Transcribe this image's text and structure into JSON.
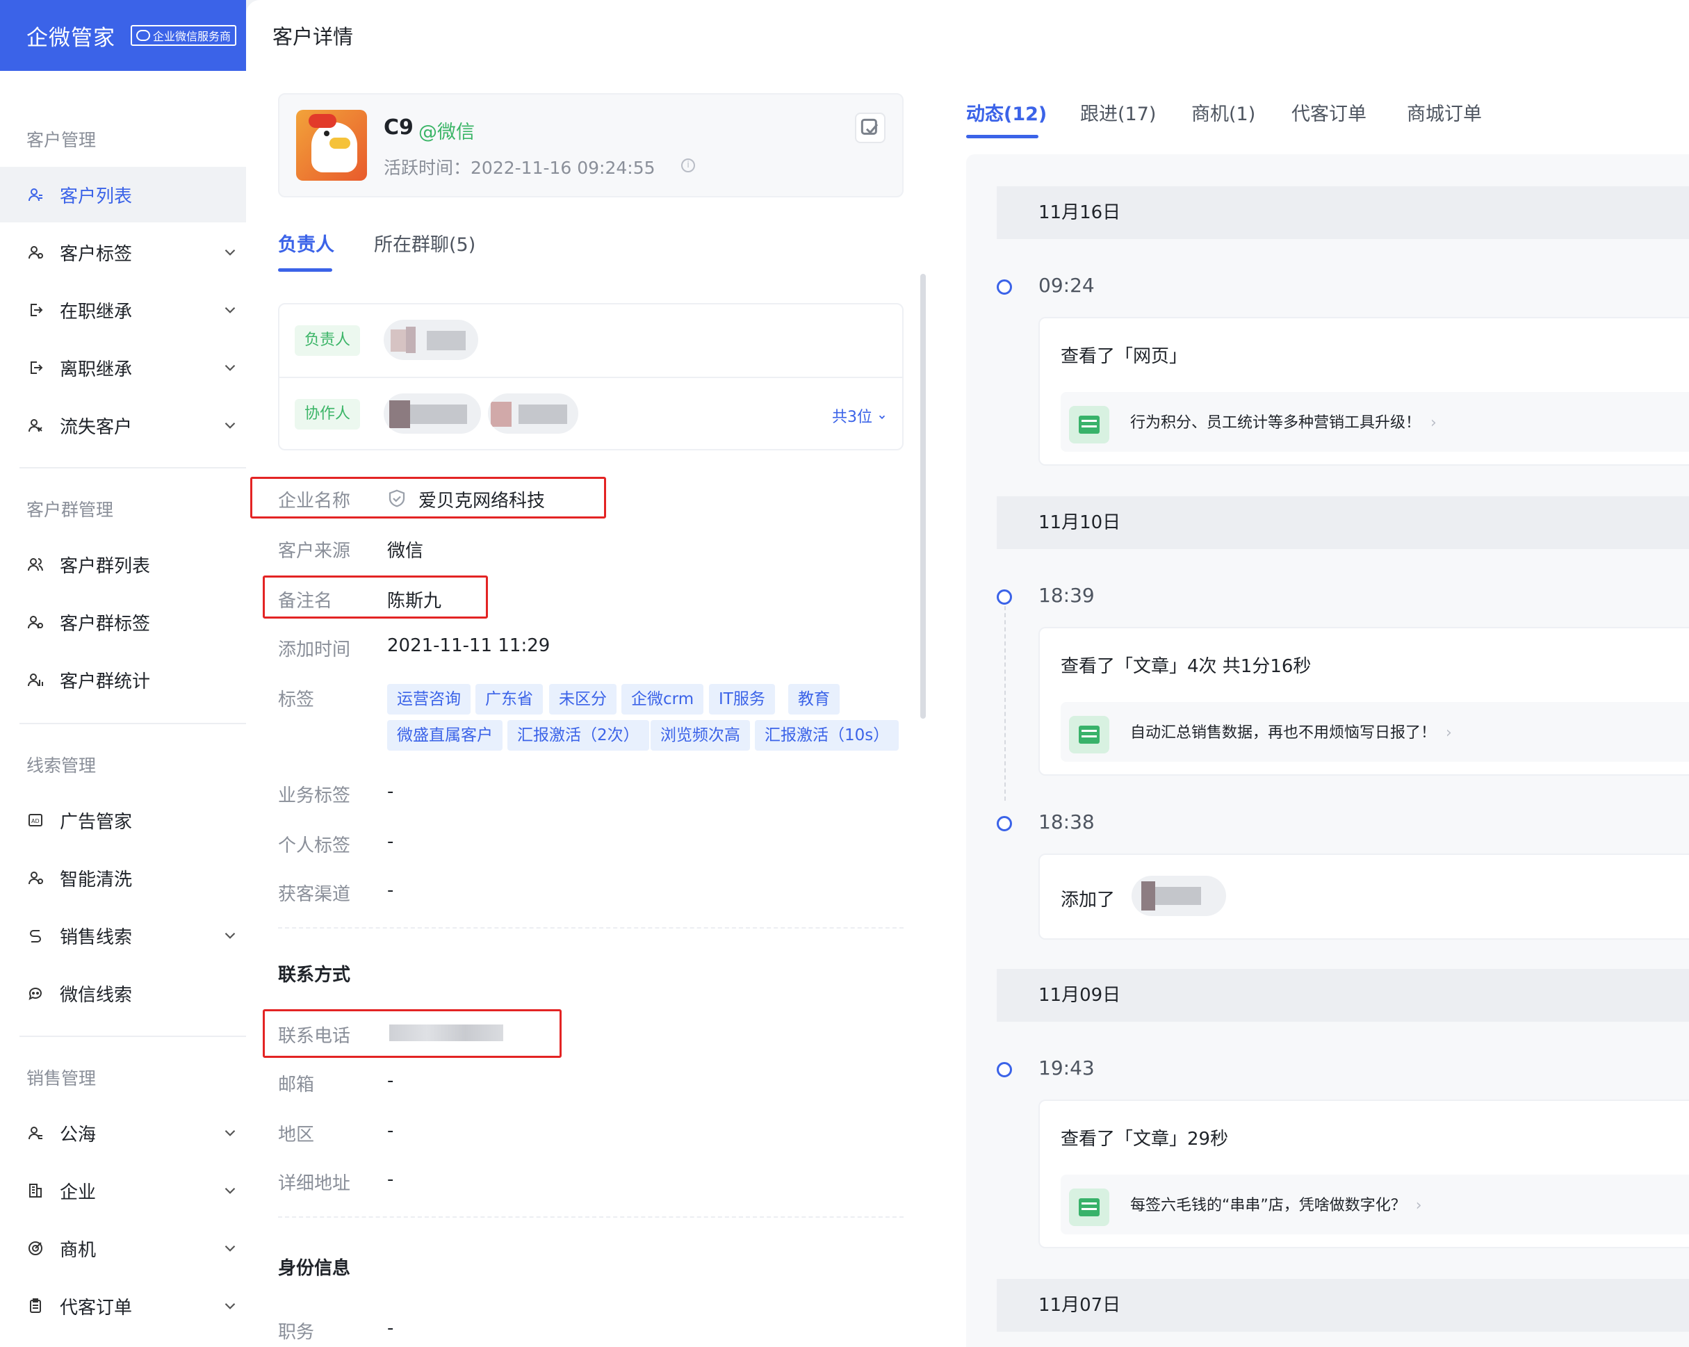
{
  "brand": {
    "name": "企微管家",
    "badge": "企业微信服务商"
  },
  "sidebar": {
    "sections": [
      {
        "title": "客户管理",
        "items": [
          "客户列表",
          "客户标签",
          "在职继承",
          "离职继承",
          "流失客户"
        ]
      },
      {
        "title": "客户群管理",
        "items": [
          "客户群列表",
          "客户群标签",
          "客户群统计"
        ]
      },
      {
        "title": "线索管理",
        "items": [
          "广告管家",
          "智能清洗",
          "销售线索",
          "微信线索"
        ]
      },
      {
        "title": "销售管理",
        "items": [
          "公海",
          "企业",
          "商机",
          "代客订单"
        ]
      }
    ],
    "active_item": "客户列表"
  },
  "page": {
    "title": "客户详情"
  },
  "customer": {
    "name": "C9",
    "source_tag": "@微信",
    "active_label": "活跃时间：",
    "active_time": "2022-11-16 09:24:55",
    "info_icon": "i"
  },
  "left_tabs": [
    "负责人",
    "所在群聊(5)"
  ],
  "owners": {
    "owner_label": "负责人",
    "collab_label": "协作人",
    "more": "共3位"
  },
  "details": {
    "company_label": "企业名称",
    "company": "爱贝克网络科技",
    "source_label": "客户来源",
    "source": "微信",
    "remark_label": "备注名",
    "remark": "陈斯九",
    "added_label": "添加时间",
    "added": "2021-11-11 11:29",
    "tags_label": "标签",
    "tags_row1": [
      "运营咨询",
      "广东省",
      "未区分",
      "企微crm",
      "IT服务",
      "教育"
    ],
    "tags_row2": [
      "微盛直属客户",
      "汇报激活（2次）",
      "浏览频次高",
      "汇报激活（10s）"
    ],
    "biz_tag_label": "业务标签",
    "biz_tag": "-",
    "personal_tag_label": "个人标签",
    "personal_tag": "-",
    "channel_label": "获客渠道",
    "channel": "-"
  },
  "contact": {
    "title": "联系方式",
    "phone_label": "联系电话",
    "email_label": "邮箱",
    "email": "-",
    "region_label": "地区",
    "region": "-",
    "address_label": "详细地址",
    "address": "-"
  },
  "identity": {
    "title": "身份信息",
    "job_label": "职务",
    "job": "-"
  },
  "right_tabs": [
    "动态(12)",
    "跟进(17)",
    "商机(1)",
    "代客订单",
    "商城订单"
  ],
  "feed": {
    "day1": "11月16日",
    "e1_time": "09:24",
    "e1_text": "查看了「网页」",
    "e1_sub": "行为积分、员工统计等多种营销工具升级！",
    "day2": "11月10日",
    "e2_time": "18:39",
    "e2_text": "查看了「文章」4次 共1分16秒",
    "e2_sub": "自动汇总销售数据，再也不用烦恼写日报了！",
    "e3_time": "18:38",
    "e3_text": "添加了",
    "day3": "11月09日",
    "e4_time": "19:43",
    "e4_text": "查看了「文章」29秒",
    "e4_sub": "每签六毛钱的“串串”店，凭啥做数字化？",
    "day4": "11月07日",
    "arrow": "›"
  },
  "colors": {
    "accent": "#3b63e8",
    "brand_bg": "#3b63e8",
    "green": "#3bb567",
    "highlight": "#e32424"
  }
}
